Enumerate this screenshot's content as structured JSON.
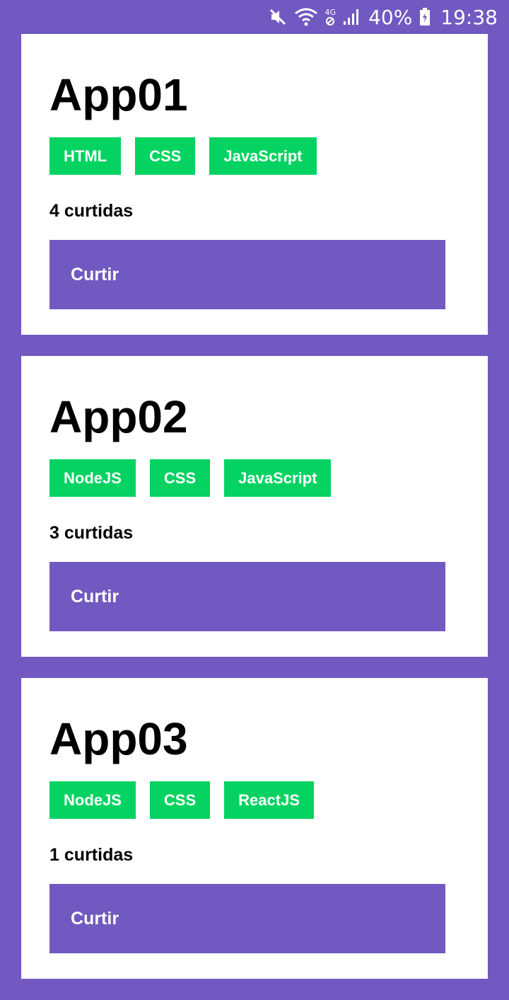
{
  "status_bar": {
    "network_label": "4G",
    "battery": "40%",
    "time": "19:38",
    "icons": [
      "mute-icon",
      "wifi-icon",
      "network-4g-icon",
      "signal-icon",
      "battery-icon"
    ]
  },
  "colors": {
    "background": "#7159c1",
    "card": "#ffffff",
    "tag": "#04d361",
    "button": "#7159c1"
  },
  "repositories": [
    {
      "title": "App01",
      "techs": [
        "HTML",
        "CSS",
        "JavaScript"
      ],
      "likes_count": "4",
      "likes_suffix": "curtidas",
      "like_label": "Curtir"
    },
    {
      "title": "App02",
      "techs": [
        "NodeJS",
        "CSS",
        "JavaScript"
      ],
      "likes_count": "3",
      "likes_suffix": "curtidas",
      "like_label": "Curtir"
    },
    {
      "title": "App03",
      "techs": [
        "NodeJS",
        "CSS",
        "ReactJS"
      ],
      "likes_count": "1",
      "likes_suffix": "curtidas",
      "like_label": "Curtir"
    }
  ]
}
